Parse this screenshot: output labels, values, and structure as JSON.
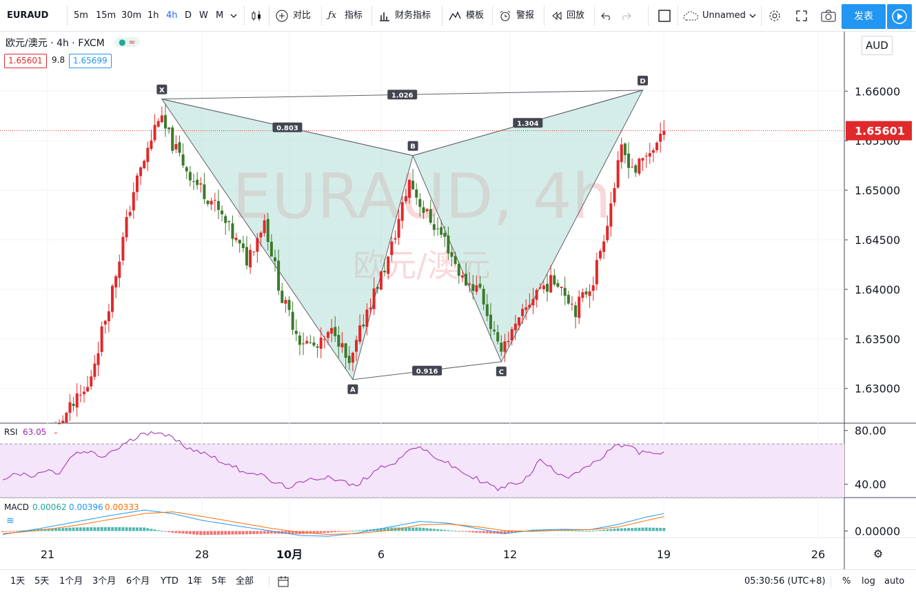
{
  "toolbar": {
    "symbol": "EURAUD",
    "intervals": [
      "5m",
      "15m",
      "30m",
      "1h",
      "4h",
      "D",
      "W",
      "M"
    ],
    "active_interval": "4h",
    "compare_label": "对比",
    "indicators_label": "指标",
    "financials_label": "财务指标",
    "templates_label": "模板",
    "alert_label": "警报",
    "replay_label": "回放",
    "layout_name": "Unnamed",
    "publish_label": "发表"
  },
  "legend": {
    "title": "欧元/澳元 · 4h · FXCM",
    "bid": "1.65601",
    "spread": "9.8",
    "ask": "1.65699"
  },
  "watermark": {
    "line1": "EURAUD, 4h",
    "line2": "欧元/澳元"
  },
  "currency_label": "AUD",
  "chart_data": [
    {
      "type": "candlestick",
      "ylim": [
        1.6265,
        1.666
      ],
      "y_ticks": [
        "1.63000",
        "1.63500",
        "1.64000",
        "1.64500",
        "1.65000",
        "1.65500",
        "1.66000"
      ],
      "x_ticks": [
        "21",
        "28",
        "10月",
        "6",
        "12",
        "19",
        "26"
      ],
      "last_price": "1.65601",
      "last_price_value": 1.65601,
      "pattern": {
        "name": "XABCD",
        "points": [
          {
            "label": "X",
            "bar": 45,
            "price": 1.6592
          },
          {
            "label": "A",
            "bar": 99,
            "price": 1.6309
          },
          {
            "label": "B",
            "bar": 116,
            "price": 1.6535
          },
          {
            "label": "C",
            "bar": 141,
            "price": 1.6327
          },
          {
            "label": "D",
            "bar": 181,
            "price": 1.6601
          }
        ],
        "ratios": [
          {
            "label": "0.803",
            "from": "X",
            "to": "B"
          },
          {
            "label": "0.916",
            "from": "A",
            "to": "C"
          },
          {
            "label": "1.304",
            "from": "B",
            "to": "D"
          },
          {
            "label": "1.026",
            "from": "X",
            "to": "D"
          }
        ]
      },
      "anchors": [
        [
          0,
          1.618
        ],
        [
          10,
          1.62
        ],
        [
          18,
          1.627
        ],
        [
          25,
          1.63
        ],
        [
          32,
          1.64
        ],
        [
          38,
          1.65
        ],
        [
          42,
          1.654
        ],
        [
          45,
          1.6575
        ],
        [
          50,
          1.654
        ],
        [
          55,
          1.651
        ],
        [
          60,
          1.649
        ],
        [
          65,
          1.646
        ],
        [
          70,
          1.643
        ],
        [
          75,
          1.647
        ],
        [
          80,
          1.639
        ],
        [
          85,
          1.635
        ],
        [
          90,
          1.634
        ],
        [
          95,
          1.636
        ],
        [
          99,
          1.632
        ],
        [
          104,
          1.638
        ],
        [
          110,
          1.643
        ],
        [
          116,
          1.651
        ],
        [
          120,
          1.648
        ],
        [
          126,
          1.645
        ],
        [
          131,
          1.641
        ],
        [
          136,
          1.64
        ],
        [
          141,
          1.634
        ],
        [
          146,
          1.636
        ],
        [
          152,
          1.64
        ],
        [
          158,
          1.641
        ],
        [
          163,
          1.638
        ],
        [
          168,
          1.641
        ],
        [
          172,
          1.647
        ],
        [
          176,
          1.654
        ],
        [
          180,
          1.652
        ],
        [
          184,
          1.654
        ],
        [
          187,
          1.655
        ]
      ]
    },
    {
      "type": "line",
      "name": "RSI",
      "value": "63.05",
      "ylim": [
        30,
        85
      ],
      "y_ticks": [
        "80.00",
        "40.00"
      ],
      "bands": [
        30,
        70
      ],
      "points": [
        [
          0,
          44
        ],
        [
          4,
          48
        ],
        [
          8,
          45
        ],
        [
          12,
          50
        ],
        [
          16,
          48
        ],
        [
          20,
          62
        ],
        [
          24,
          64
        ],
        [
          28,
          60
        ],
        [
          32,
          66
        ],
        [
          36,
          72
        ],
        [
          40,
          78
        ],
        [
          44,
          80
        ],
        [
          48,
          74
        ],
        [
          52,
          68
        ],
        [
          56,
          64
        ],
        [
          60,
          60
        ],
        [
          64,
          54
        ],
        [
          68,
          50
        ],
        [
          72,
          48
        ],
        [
          76,
          42
        ],
        [
          80,
          38
        ],
        [
          84,
          40
        ],
        [
          88,
          44
        ],
        [
          92,
          46
        ],
        [
          96,
          42
        ],
        [
          100,
          38
        ],
        [
          104,
          48
        ],
        [
          108,
          54
        ],
        [
          112,
          58
        ],
        [
          116,
          68
        ],
        [
          120,
          64
        ],
        [
          124,
          58
        ],
        [
          128,
          52
        ],
        [
          132,
          46
        ],
        [
          136,
          42
        ],
        [
          140,
          36
        ],
        [
          144,
          40
        ],
        [
          148,
          44
        ],
        [
          152,
          58
        ],
        [
          156,
          50
        ],
        [
          160,
          46
        ],
        [
          164,
          52
        ],
        [
          168,
          56
        ],
        [
          172,
          66
        ],
        [
          176,
          70
        ],
        [
          180,
          64
        ],
        [
          184,
          62
        ],
        [
          187,
          63
        ]
      ]
    },
    {
      "type": "bar",
      "name": "MACD",
      "values_text": [
        "0.00062",
        "0.00396",
        "0.00333"
      ],
      "ylim": [
        -0.0015,
        0.0075
      ],
      "y_ticks": [
        "0.00000"
      ],
      "macd_line": [
        [
          0,
          -0.0008
        ],
        [
          10,
          0.0005
        ],
        [
          20,
          0.002
        ],
        [
          30,
          0.0035
        ],
        [
          40,
          0.0048
        ],
        [
          48,
          0.004
        ],
        [
          56,
          0.0025
        ],
        [
          66,
          0.0012
        ],
        [
          76,
          0.0
        ],
        [
          84,
          -0.001
        ],
        [
          92,
          -0.0012
        ],
        [
          100,
          -0.0005
        ],
        [
          110,
          0.001
        ],
        [
          118,
          0.0022
        ],
        [
          126,
          0.0018
        ],
        [
          134,
          0.0006
        ],
        [
          142,
          -0.0006
        ],
        [
          150,
          0.0002
        ],
        [
          158,
          0.0004
        ],
        [
          166,
          0.0003
        ],
        [
          174,
          0.0015
        ],
        [
          182,
          0.0032
        ],
        [
          187,
          0.004
        ]
      ],
      "signal_line": [
        [
          0,
          -0.0006
        ],
        [
          10,
          0.0001
        ],
        [
          20,
          0.0012
        ],
        [
          30,
          0.0026
        ],
        [
          40,
          0.004
        ],
        [
          48,
          0.0044
        ],
        [
          56,
          0.0034
        ],
        [
          66,
          0.002
        ],
        [
          76,
          0.0006
        ],
        [
          84,
          -0.0003
        ],
        [
          92,
          -0.0008
        ],
        [
          100,
          -0.0006
        ],
        [
          110,
          0.0002
        ],
        [
          118,
          0.0014
        ],
        [
          126,
          0.0016
        ],
        [
          134,
          0.001
        ],
        [
          142,
          0.0001
        ],
        [
          150,
          -0.0001
        ],
        [
          158,
          0.0002
        ],
        [
          166,
          0.0003
        ],
        [
          174,
          0.0009
        ],
        [
          182,
          0.0024
        ],
        [
          187,
          0.0033
        ]
      ],
      "colors": {
        "macd": "#2196f3",
        "signal": "#ff6d00",
        "hist_up": "#26a69a",
        "hist_down": "#ef5350"
      }
    }
  ],
  "bottom": {
    "ranges": [
      "1天",
      "5天",
      "1个月",
      "3个月",
      "6个月",
      "YTD",
      "1年",
      "5年",
      "全部"
    ],
    "time": "05:30:56 (UTC+8)",
    "percent": "%",
    "log": "log",
    "auto": "auto"
  },
  "colors": {
    "up": "#e0292a",
    "down": "#3b7a2c",
    "pattern_fill": "rgba(162, 214, 204, 0.45)",
    "rsi_fill": "#f5e5fb",
    "rsi_line": "#9c27b0",
    "price_label_bg": "#e0292a"
  }
}
